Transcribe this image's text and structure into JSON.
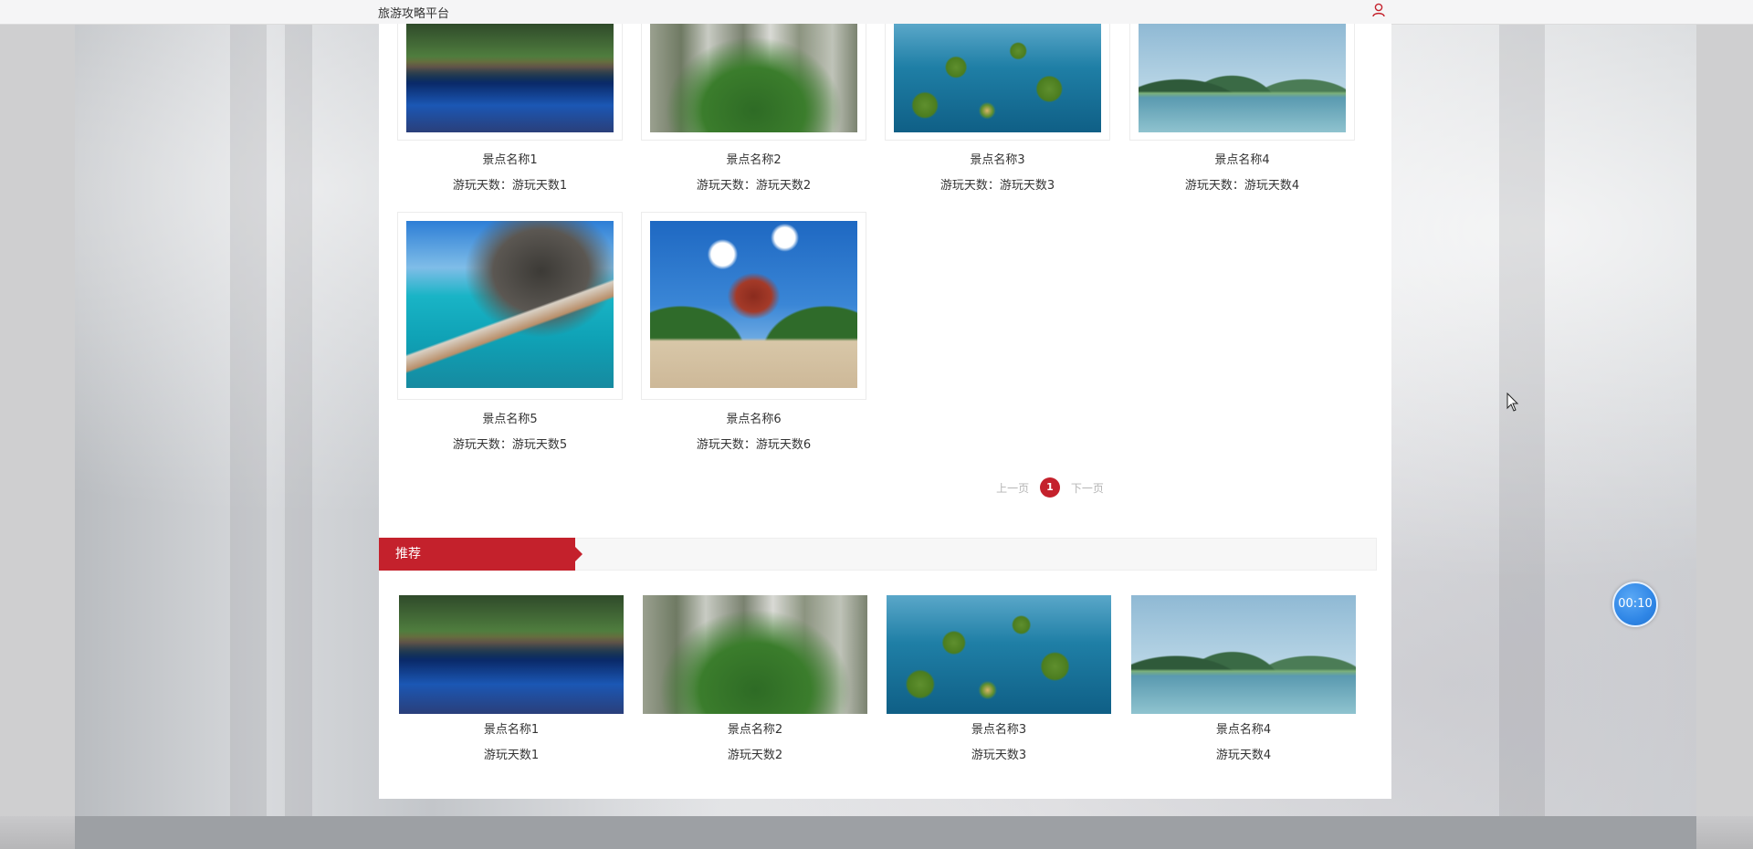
{
  "header": {
    "brand": "旅游攻略平台",
    "user_icon": "user-icon",
    "accent": "#c4212c"
  },
  "spots": [
    {
      "name": "景点名称1",
      "days": "游玩天数：游玩天数1",
      "image": "pagoda-lake"
    },
    {
      "name": "景点名称2",
      "days": "游玩天数：游玩天数2",
      "image": "stone-peaks"
    },
    {
      "name": "景点名称3",
      "days": "游玩天数：游玩天数3",
      "image": "lake-islands"
    },
    {
      "name": "景点名称4",
      "days": "游玩天数：游玩天数4",
      "image": "karst-river"
    },
    {
      "name": "景点名称5",
      "days": "游玩天数：游玩天数5",
      "image": "boat-lagoon"
    },
    {
      "name": "景点名称6",
      "days": "游玩天数：游玩天数6",
      "image": "red-pagoda"
    }
  ],
  "pagination": {
    "prev": "上一页",
    "current": "1",
    "next": "下一页"
  },
  "recommend": {
    "title": "推荐",
    "items": [
      {
        "name": "景点名称1",
        "days": "游玩天数1",
        "image": "pagoda-lake"
      },
      {
        "name": "景点名称2",
        "days": "游玩天数2",
        "image": "stone-peaks"
      },
      {
        "name": "景点名称3",
        "days": "游玩天数3",
        "image": "lake-islands"
      },
      {
        "name": "景点名称4",
        "days": "游玩天数4",
        "image": "karst-river"
      }
    ]
  },
  "timer": "00:10"
}
